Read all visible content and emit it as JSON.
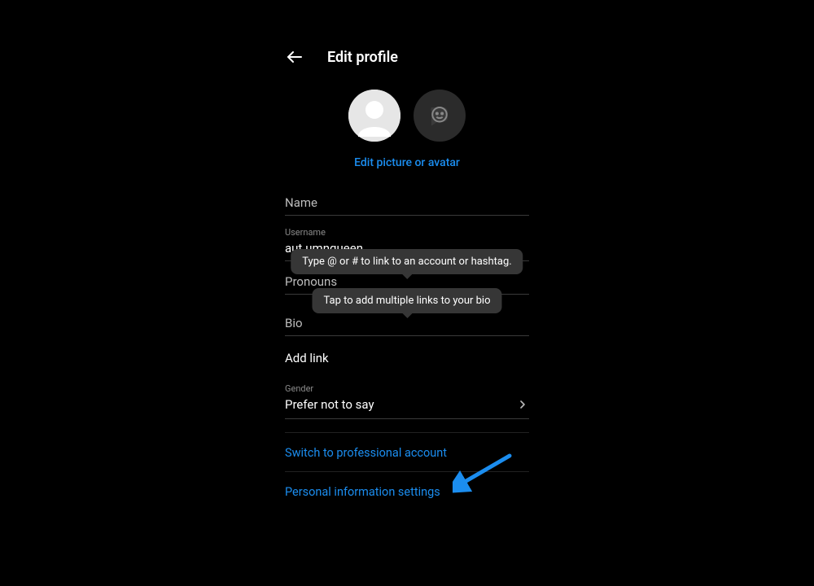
{
  "header": {
    "title": "Edit profile"
  },
  "editPictureLink": "Edit picture or avatar",
  "fields": {
    "name": {
      "label": "Name"
    },
    "username": {
      "label": "Username",
      "value": "aut.umnqueen"
    },
    "pronouns": {
      "label": "Pronouns"
    },
    "bio": {
      "label": "Bio"
    },
    "addLink": "Add link",
    "gender": {
      "label": "Gender",
      "value": "Prefer not to say"
    }
  },
  "tooltips": {
    "bioHint": "Type @ or # to link to an account or hashtag.",
    "linkHint": "Tap to add multiple links to your bio"
  },
  "actions": {
    "switchProfessional": "Switch to professional account",
    "personalInfo": "Personal information settings"
  }
}
